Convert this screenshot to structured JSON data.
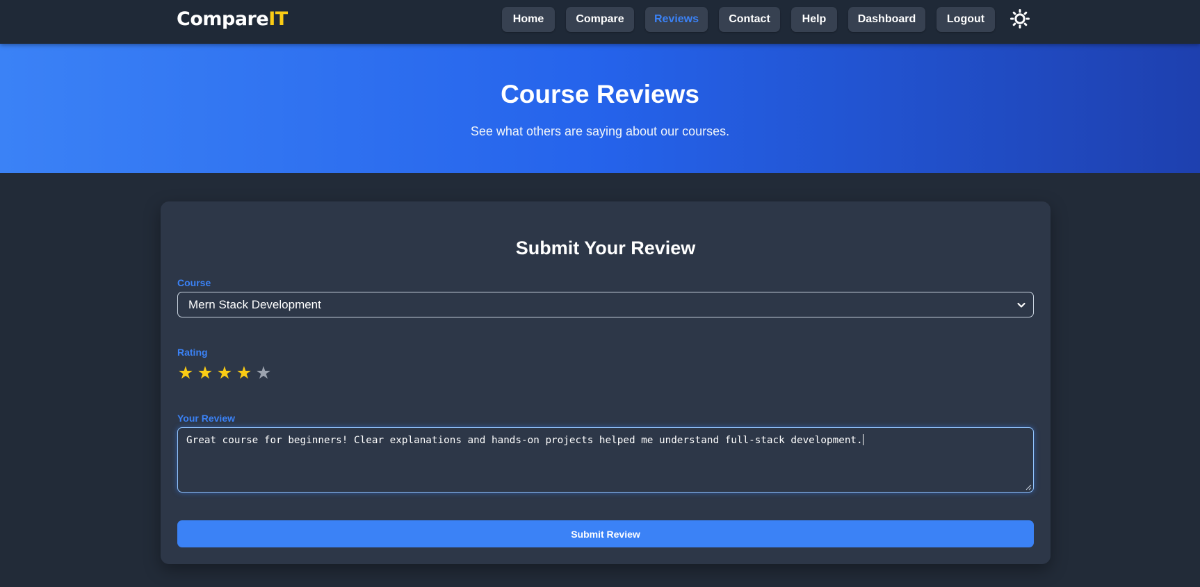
{
  "brand": {
    "main": "Compare",
    "accent": "IT"
  },
  "nav": {
    "items": [
      {
        "label": "Home"
      },
      {
        "label": "Compare"
      },
      {
        "label": "Reviews",
        "active": true
      },
      {
        "label": "Contact"
      },
      {
        "label": "Help"
      },
      {
        "label": "Dashboard"
      },
      {
        "label": "Logout"
      }
    ],
    "theme_toggle_icon": "sun-icon"
  },
  "hero": {
    "title": "Course Reviews",
    "subtitle": "See what others are saying about our courses."
  },
  "form": {
    "title": "Submit Your Review",
    "course_label": "Course",
    "course_value": "Mern Stack Development",
    "rating_label": "Rating",
    "rating": {
      "value": 4,
      "max": 5
    },
    "review_label": "Your Review",
    "review_text": "Great course for beginners! Clear explanations and hands-on projects helped me understand full-stack development.",
    "submit_label": "Submit Review"
  },
  "colors": {
    "page_bg": "#222b38",
    "navbar_bg": "#1f2937",
    "card_bg": "#2d3748",
    "accent_blue": "#3b82f6",
    "brand_accent_yellow": "#facc15",
    "star_filled": "#facc15",
    "star_empty": "#9ca3af",
    "hero_gradient_start": "#3b82f6",
    "hero_gradient_end": "#1e40af"
  }
}
